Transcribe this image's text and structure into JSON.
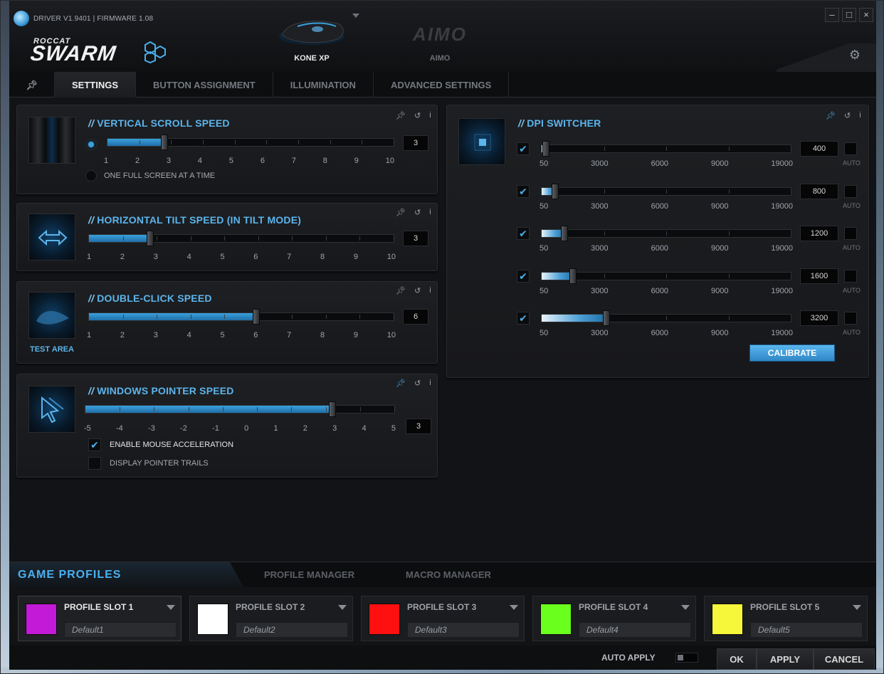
{
  "titlebar": {
    "driver_text": "DRIVER V1.9401 | FIRMWARE 1.08",
    "brand_top": "ROCCAT",
    "brand_main": "SWARM",
    "devices": [
      {
        "name": "KONE XP",
        "active": true
      },
      {
        "logo": "AIMO",
        "name": "AIMO",
        "active": false
      }
    ],
    "window_buttons": {
      "minimize": "–",
      "maximize": "□",
      "close": "×"
    },
    "settings_icon": "gear-icon"
  },
  "tabs": [
    {
      "label": "",
      "icon": "pin-icon"
    },
    {
      "label": "SETTINGS",
      "active": true
    },
    {
      "label": "BUTTON ASSIGNMENT"
    },
    {
      "label": "ILLUMINATION"
    },
    {
      "label": "ADVANCED SETTINGS"
    }
  ],
  "scroll": {
    "title": "VERTICAL SCROLL SPEED",
    "value": "3",
    "scale": [
      "1",
      "2",
      "3",
      "4",
      "5",
      "6",
      "7",
      "8",
      "9",
      "10"
    ],
    "fraction": 0.2,
    "option_label": "ONE FULL SCREEN AT A TIME"
  },
  "tilt": {
    "title": "HORIZONTAL TILT SPEED (IN TILT MODE)",
    "value": "3",
    "scale": [
      "1",
      "2",
      "3",
      "4",
      "5",
      "6",
      "7",
      "8",
      "9",
      "10"
    ],
    "fraction": 0.2
  },
  "dblclick": {
    "title": "DOUBLE-CLICK SPEED",
    "value": "6",
    "scale": [
      "1",
      "2",
      "3",
      "4",
      "5",
      "6",
      "7",
      "8",
      "9",
      "10"
    ],
    "fraction": 0.55,
    "test_area": "TEST AREA"
  },
  "pointer": {
    "title": "WINDOWS POINTER SPEED",
    "value": "3",
    "scale": [
      "-5",
      "-4",
      "-3",
      "-2",
      "-1",
      "0",
      "1",
      "2",
      "3",
      "4",
      "5"
    ],
    "fraction": 0.8,
    "accel_label": "ENABLE MOUSE ACCELERATION",
    "trails_label": "DISPLAY POINTER TRAILS"
  },
  "dpi": {
    "title": "DPI SWITCHER",
    "scale": [
      "50",
      "3000",
      "6000",
      "9000",
      "19000"
    ],
    "auto_label": "AUTO",
    "calibrate": "CALIBRATE",
    "levels": [
      {
        "value": "400",
        "fraction": 0.018
      },
      {
        "value": "800",
        "fraction": 0.055
      },
      {
        "value": "1200",
        "fraction": 0.09
      },
      {
        "value": "1600",
        "fraction": 0.125
      },
      {
        "value": "3200",
        "fraction": 0.26
      }
    ]
  },
  "bottom_tabs": {
    "game_profiles": "GAME PROFILES",
    "profile_manager": "PROFILE MANAGER",
    "macro_manager": "MACRO MANAGER"
  },
  "profiles": [
    {
      "name": "PROFILE SLOT 1",
      "value": "Default1",
      "color": "#c21ad6"
    },
    {
      "name": "PROFILE SLOT 2",
      "value": "Default2",
      "color": "#ffffff"
    },
    {
      "name": "PROFILE SLOT 3",
      "value": "Default3",
      "color": "#ff1010"
    },
    {
      "name": "PROFILE SLOT 4",
      "value": "Default4",
      "color": "#6aff1c"
    },
    {
      "name": "PROFILE SLOT 5",
      "value": "Default5",
      "color": "#f6f63a"
    }
  ],
  "footer": {
    "auto_apply": "AUTO APPLY",
    "ok": "OK",
    "apply": "APPLY",
    "cancel": "CANCEL"
  }
}
